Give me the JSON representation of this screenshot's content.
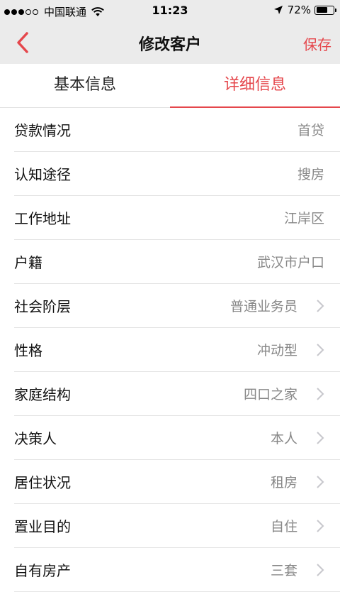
{
  "status_bar": {
    "carrier": "中国联通",
    "time": "11:23",
    "battery_percent": "72%",
    "battery_level": 0.72
  },
  "nav": {
    "title": "修改客户",
    "save_label": "保存",
    "back_icon": "chevron-left-icon"
  },
  "tabs": [
    {
      "label": "基本信息",
      "active": false
    },
    {
      "label": "详细信息",
      "active": true
    }
  ],
  "rows": [
    {
      "label": "贷款情况",
      "value": "首贷",
      "arrow": false
    },
    {
      "label": "认知途径",
      "value": "搜房",
      "arrow": false
    },
    {
      "label": "工作地址",
      "value": "江岸区",
      "arrow": false
    },
    {
      "label": "户籍",
      "value": "武汉市户口",
      "arrow": false
    },
    {
      "label": "社会阶层",
      "value": "普通业务员",
      "arrow": true
    },
    {
      "label": "性格",
      "value": "冲动型",
      "arrow": true
    },
    {
      "label": "家庭结构",
      "value": "四口之家",
      "arrow": true
    },
    {
      "label": "决策人",
      "value": "本人",
      "arrow": true
    },
    {
      "label": "居住状况",
      "value": "租房",
      "arrow": true
    },
    {
      "label": "置业目的",
      "value": "自住",
      "arrow": true
    },
    {
      "label": "自有房产",
      "value": "三套",
      "arrow": true
    }
  ],
  "colors": {
    "accent": "#e5474c",
    "header_bg": "#ebebeb",
    "value_text": "#888888"
  }
}
